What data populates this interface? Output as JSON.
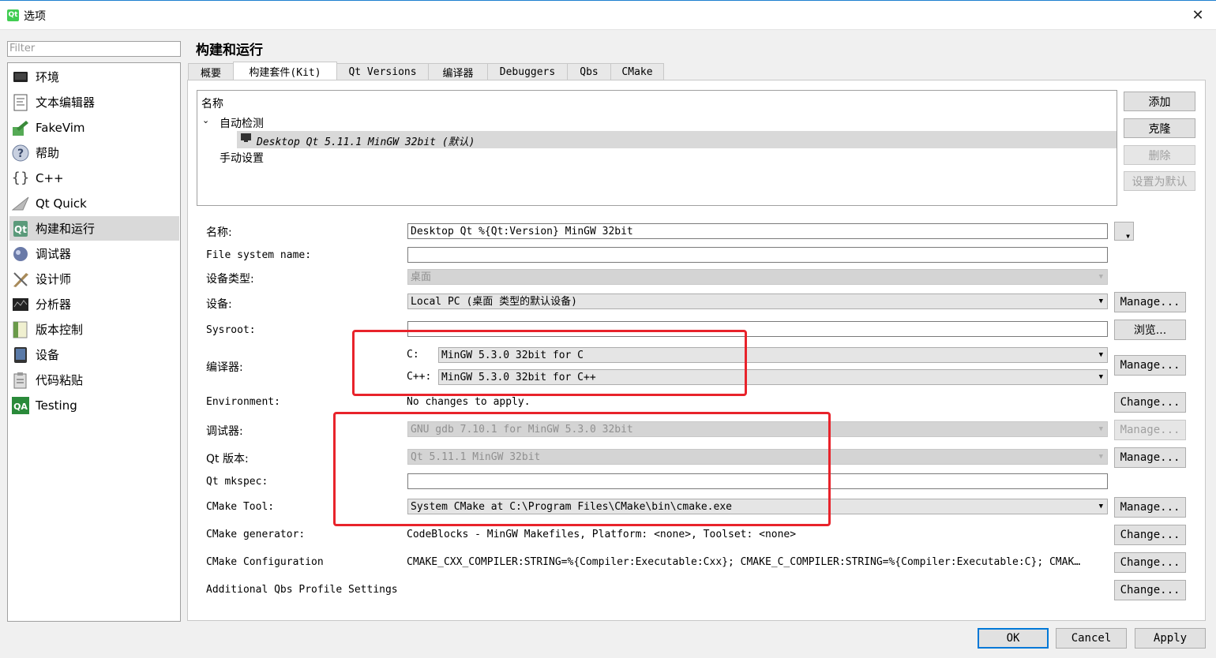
{
  "window": {
    "title": "选项",
    "app_icon": "Qt"
  },
  "sidebar": {
    "filter_placeholder": "Filter",
    "items": [
      {
        "label": "环境",
        "icon": "monitor-icon"
      },
      {
        "label": "文本编辑器",
        "icon": "text-editor-icon"
      },
      {
        "label": "FakeVim",
        "icon": "fakevim-icon"
      },
      {
        "label": "帮助",
        "icon": "help-icon"
      },
      {
        "label": "C++",
        "icon": "braces-icon"
      },
      {
        "label": "Qt Quick",
        "icon": "paper-plane-icon"
      },
      {
        "label": "构建和运行",
        "icon": "build-run-icon"
      },
      {
        "label": "调试器",
        "icon": "debugger-icon"
      },
      {
        "label": "设计师",
        "icon": "designer-icon"
      },
      {
        "label": "分析器",
        "icon": "analyzer-icon"
      },
      {
        "label": "版本控制",
        "icon": "version-control-icon"
      },
      {
        "label": "设备",
        "icon": "device-icon"
      },
      {
        "label": "代码粘贴",
        "icon": "code-paste-icon"
      },
      {
        "label": "Testing",
        "icon": "qa-icon"
      }
    ]
  },
  "main": {
    "title": "构建和运行",
    "tabs": [
      {
        "label": "概要"
      },
      {
        "label": "构建套件(Kit)"
      },
      {
        "label": "Qt Versions"
      },
      {
        "label": "编译器"
      },
      {
        "label": "Debuggers"
      },
      {
        "label": "Qbs"
      },
      {
        "label": "CMake"
      }
    ],
    "tree": {
      "header": "名称",
      "auto_detected": "自动检测",
      "kit_item": "Desktop Qt 5.11.1 MinGW 32bit (默认)",
      "manual": "手动设置"
    },
    "tree_buttons": {
      "add": "添加",
      "clone": "克隆",
      "remove": "删除",
      "set_default": "设置为默认"
    },
    "form": {
      "name_label": "名称:",
      "name_value": "Desktop Qt %{Qt:Version} MinGW 32bit",
      "fs_name_label": "File system name:",
      "fs_name_value": "",
      "device_type_label": "设备类型:",
      "device_type_value": "桌面",
      "device_label": "设备:",
      "device_value": "Local PC (桌面 类型的默认设备)",
      "device_manage": "Manage...",
      "sysroot_label": "Sysroot:",
      "sysroot_value": "",
      "sysroot_browse": "浏览...",
      "compiler_label": "编译器:",
      "c_label": "C:",
      "c_value": "MinGW 5.3.0 32bit for C",
      "cpp_label": "C++:",
      "cpp_value": "MinGW 5.3.0 32bit for C++",
      "compiler_manage": "Manage...",
      "env_label": "Environment:",
      "env_value": "No changes to apply.",
      "env_change": "Change...",
      "debugger_label": "调试器:",
      "debugger_value": "GNU gdb 7.10.1 for MinGW 5.3.0 32bit",
      "debugger_manage": "Manage...",
      "qt_version_label": "Qt 版本:",
      "qt_version_value": "Qt 5.11.1 MinGW 32bit",
      "qt_version_manage": "Manage...",
      "mkspec_label": "Qt mkspec:",
      "mkspec_value": "",
      "cmake_tool_label": "CMake Tool:",
      "cmake_tool_value": "System CMake at C:\\Program Files\\CMake\\bin\\cmake.exe",
      "cmake_tool_manage": "Manage...",
      "cmake_gen_label": "CMake generator:",
      "cmake_gen_value": "CodeBlocks - MinGW Makefiles, Platform: <none>, Toolset: <none>",
      "cmake_gen_change": "Change...",
      "cmake_conf_label": "CMake Configuration",
      "cmake_conf_value": "CMAKE_CXX_COMPILER:STRING=%{Compiler:Executable:Cxx}; CMAKE_C_COMPILER:STRING=%{Compiler:Executable:C}; CMAK…",
      "cmake_conf_change": "Change...",
      "qbs_label": "Additional Qbs Profile Settings",
      "qbs_change": "Change..."
    }
  },
  "footer": {
    "ok": "OK",
    "cancel": "Cancel",
    "apply": "Apply"
  },
  "colors": {
    "highlight_box": "#e8232b",
    "accent": "#0078d7",
    "qt_green": "#41cd52"
  }
}
